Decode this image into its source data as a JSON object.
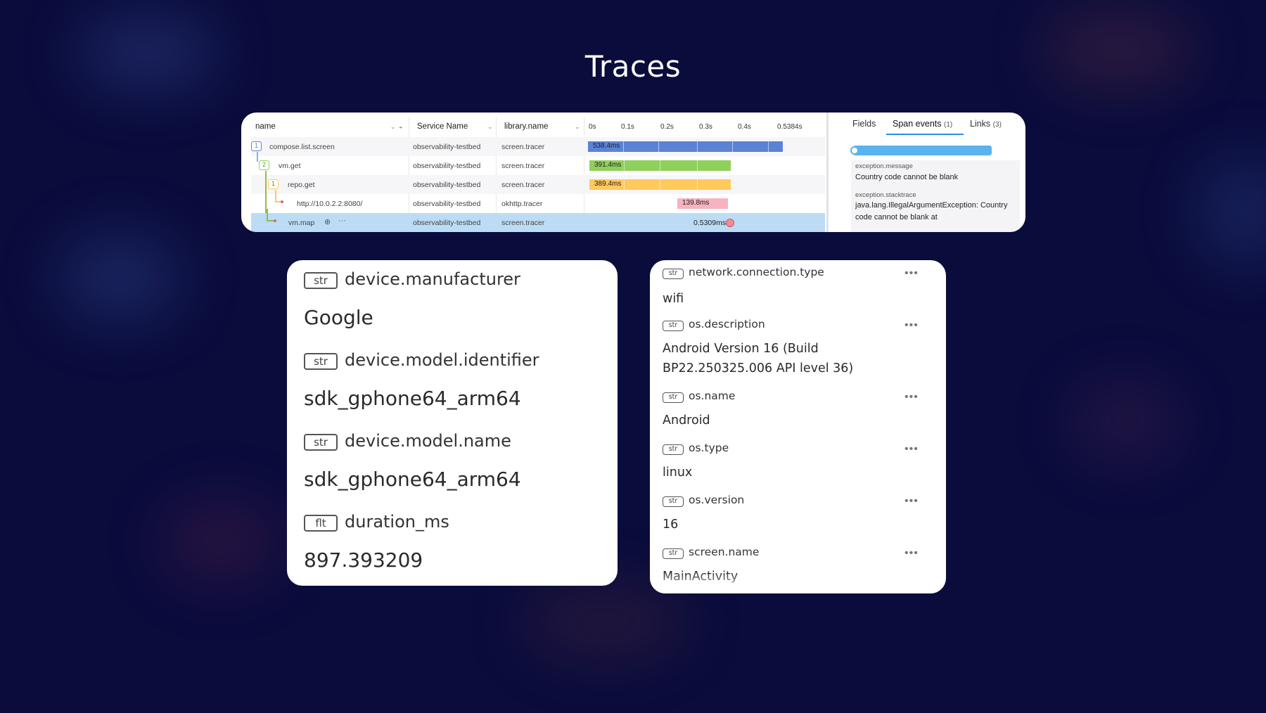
{
  "title": "Traces",
  "trace_table": {
    "columns": {
      "name": "name",
      "service": "Service Name",
      "library": "library.name"
    },
    "timeline_ticks": [
      "0s",
      "0.1s",
      "0.2s",
      "0.3s",
      "0.4s",
      "0.5384s"
    ],
    "rows": [
      {
        "badge": "1",
        "name": "compose.list.screen",
        "service": "observability-testbed",
        "library": "screen.tracer",
        "duration": "538.4ms",
        "color": "#5b82d4"
      },
      {
        "badge": "2",
        "name": "vm.get",
        "service": "observability-testbed",
        "library": "screen.tracer",
        "duration": "391.4ms",
        "color": "#8fd05a"
      },
      {
        "badge": "1",
        "name": "repo.get",
        "service": "observability-testbed",
        "library": "screen.tracer",
        "duration": "389.4ms",
        "color": "#ffc95c"
      },
      {
        "badge": "",
        "name": "http://10.0.2.2:8080/",
        "service": "observability-testbed",
        "library": "okhttp.tracer",
        "duration": "139.8ms",
        "color": "#f7b3c0"
      },
      {
        "badge": "",
        "name": "vm.map",
        "service": "observability-testbed",
        "library": "screen.tracer",
        "duration": "0.5309ms",
        "color": "#f58a96"
      }
    ]
  },
  "details": {
    "tabs": [
      {
        "label": "Fields",
        "count": ""
      },
      {
        "label": "Span events",
        "count": "(1)"
      },
      {
        "label": "Links",
        "count": "(3)"
      }
    ],
    "event": {
      "message_key": "exception.message",
      "message_val": "Country code cannot be blank",
      "trace_key": "exception.stacktrace",
      "trace_val": "java.lang.IllegalArgumentException: Country code cannot be blank at"
    }
  },
  "attributes_left": [
    {
      "type": "str",
      "key": "device.manufacturer",
      "value": "Google"
    },
    {
      "type": "str",
      "key": "device.model.identifier",
      "value": "sdk_gphone64_arm64"
    },
    {
      "type": "str",
      "key": "device.model.name",
      "value": "sdk_gphone64_arm64"
    },
    {
      "type": "flt",
      "key": "duration_ms",
      "value": "897.393209"
    }
  ],
  "attributes_right": [
    {
      "type": "str",
      "key": "network.connection.type",
      "value": "wifi"
    },
    {
      "type": "str",
      "key": "os.description",
      "value": "Android Version 16 (Build BP22.250325.006 API level 36)"
    },
    {
      "type": "str",
      "key": "os.name",
      "value": "Android"
    },
    {
      "type": "str",
      "key": "os.type",
      "value": "linux"
    },
    {
      "type": "str",
      "key": "os.version",
      "value": "16"
    },
    {
      "type": "str",
      "key": "screen.name",
      "value": "MainActivity"
    }
  ],
  "more_menu": "•••"
}
